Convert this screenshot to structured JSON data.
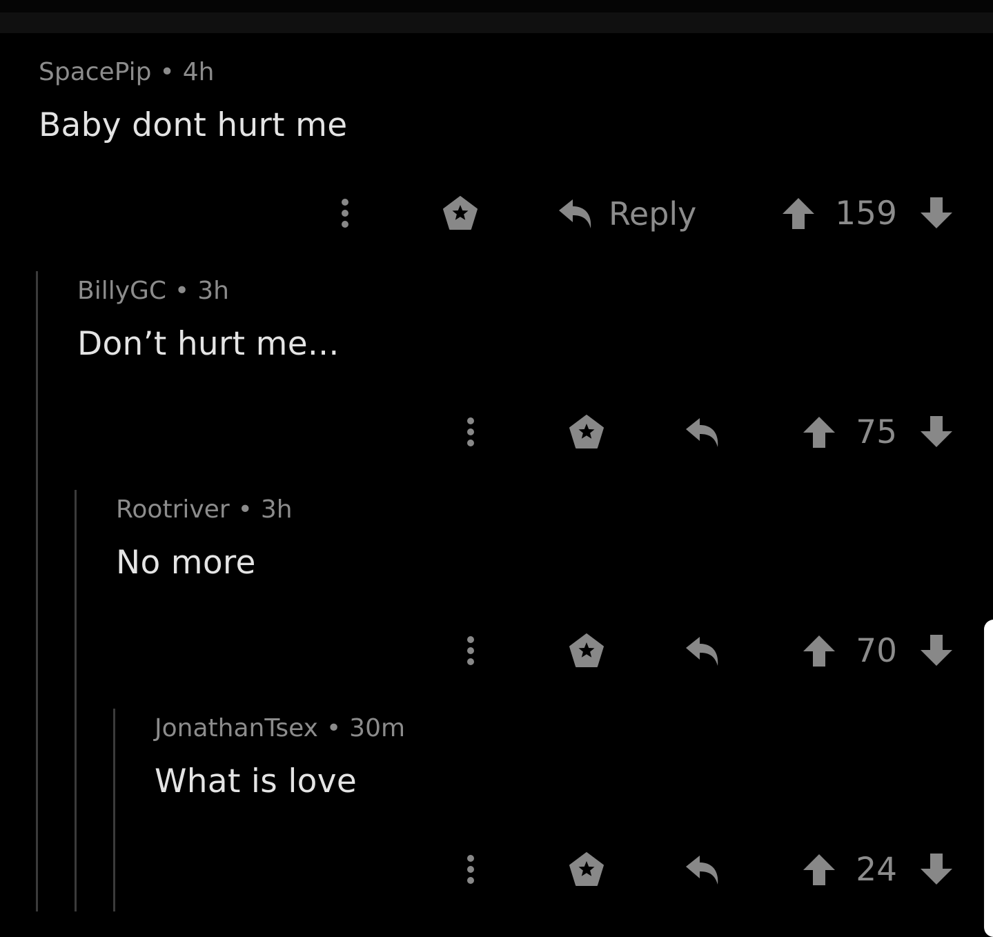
{
  "colors": {
    "background": "#000000",
    "meta_text": "#8c8c8c",
    "body_text": "#e4e4e4",
    "icon": "#888888",
    "thread_line": "#3b3b3b"
  },
  "comments": [
    {
      "author": "SpacePip",
      "separator": "•",
      "age": "4h",
      "text": "Baby dont hurt me",
      "reply_label": "Reply",
      "score": "159",
      "icons": [
        "more-vertical-icon",
        "award-icon",
        "reply-icon",
        "upvote-icon",
        "downvote-icon"
      ]
    },
    {
      "author": "BillyGC",
      "separator": "•",
      "age": "3h",
      "text": "Don’t hurt me...",
      "score": "75",
      "icons": [
        "more-vertical-icon",
        "award-icon",
        "reply-icon",
        "upvote-icon",
        "downvote-icon"
      ]
    },
    {
      "author": "Rootriver",
      "separator": "•",
      "age": "3h",
      "text": "No more",
      "score": "70",
      "icons": [
        "more-vertical-icon",
        "award-icon",
        "reply-icon",
        "upvote-icon",
        "downvote-icon"
      ]
    },
    {
      "author": "JonathanTsex",
      "separator": "•",
      "age": "30m",
      "text": "What is love",
      "score": "24",
      "icons": [
        "more-vertical-icon",
        "award-icon",
        "reply-icon",
        "upvote-icon",
        "downvote-icon"
      ]
    }
  ]
}
